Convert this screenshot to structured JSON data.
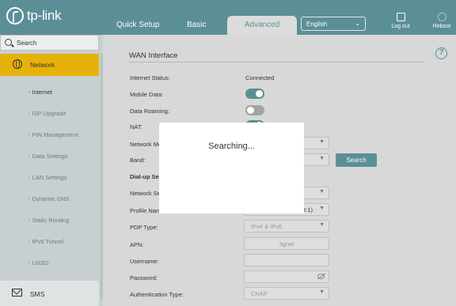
{
  "header": {
    "logo_text": "tp-link",
    "tabs": [
      "Quick Setup",
      "Basic",
      "Advanced"
    ],
    "language": "English",
    "logout_label": "Log out",
    "reboot_label": "Reboot",
    "accent_color": "#5b8f96"
  },
  "sidebar": {
    "search_label": "Search",
    "network_label": "Network",
    "sub_items": [
      "- Internet",
      "- ISP Upgrade",
      "- PIN Management",
      "- Data Settings",
      "- LAN Settings",
      "- Dynamic DNS",
      "- Static Routing",
      "- IPv6 Tunnel",
      "- USSD"
    ],
    "sms_label": "SMS",
    "active_color": "#e6b20a"
  },
  "main": {
    "section_title": "WAN Interface",
    "labels": {
      "internet_status": "Internet Status:",
      "mobile_data": "Mobile Data:",
      "data_roaming": "Data Roaming:",
      "nat": "NAT:",
      "network_mode": "Network Mo",
      "band": "Band:",
      "dialup": "Dial-up Setti",
      "network_search": "Network Sea",
      "profile_name": "Profile Name",
      "pdp_type": "PDP Type:",
      "apn": "APN:",
      "username": "Username:",
      "password": "Password:",
      "auth_type": "Authentication Type:"
    },
    "internet_status_value": "Connected",
    "mobile_data_on": true,
    "data_roaming_on": false,
    "nat_on": true,
    "profile_suffix": "lt:1)",
    "pdp_type_value": "IPv4 & IPv6",
    "apn_value": "3gnet",
    "auth_type_value": "CHAP",
    "search_button": "Search"
  },
  "modal": {
    "message": "Searching..."
  }
}
